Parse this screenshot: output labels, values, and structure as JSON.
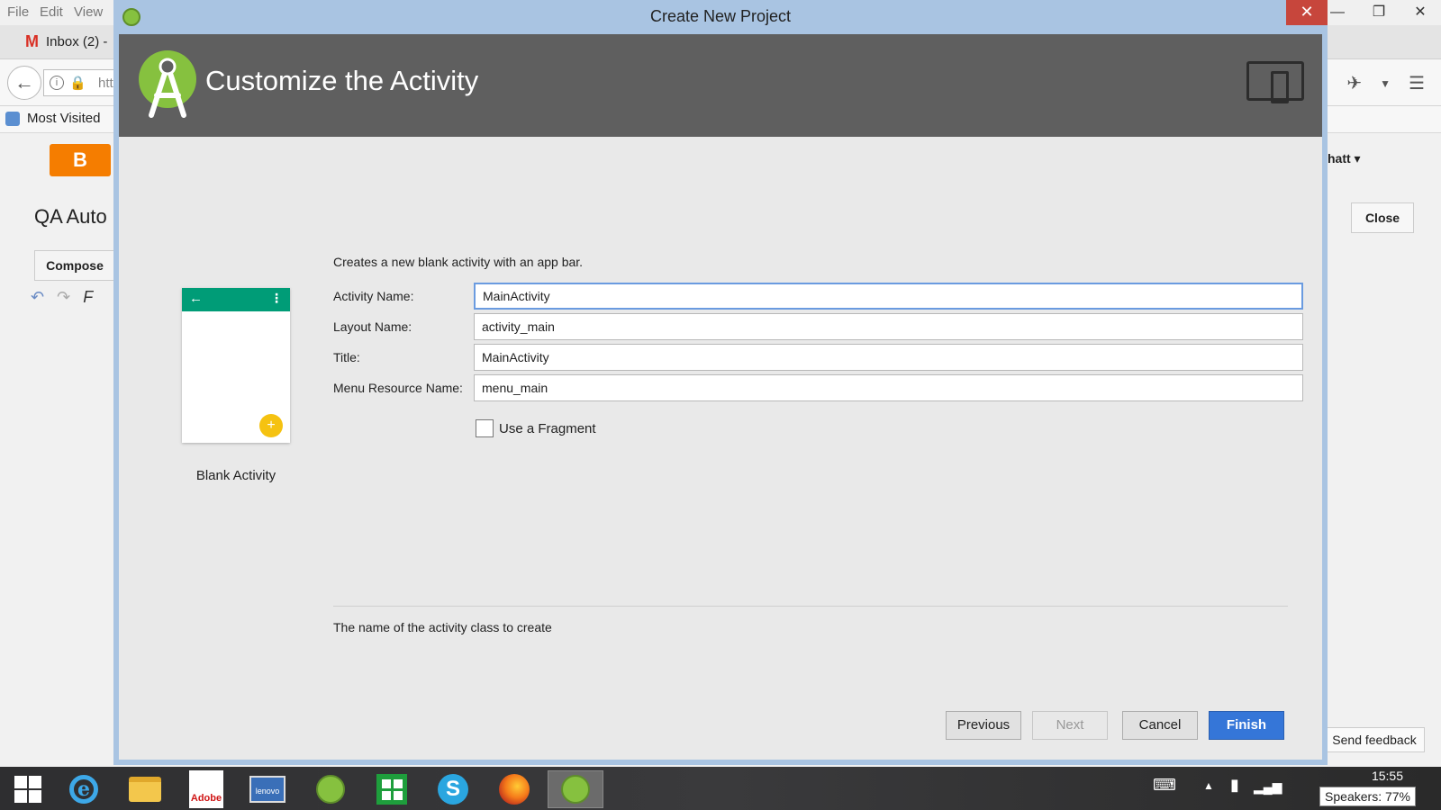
{
  "browser": {
    "menus": [
      "File",
      "Edit",
      "View"
    ],
    "tab_title": "Inbox (2) -",
    "url_fragment": "htt",
    "bookmarks_label": "Most Visited",
    "page_title": "QA Auto",
    "compose_label": "Compose",
    "user_name": "hatt",
    "close_label": "Close",
    "send_feedback_label": "Send feedback"
  },
  "dialog": {
    "window_title": "Create New Project",
    "header_title": "Customize the Activity",
    "description": "Creates a new blank activity with an app bar.",
    "preview_label": "Blank Activity",
    "fields": [
      {
        "label": "Activity Name:",
        "value": "MainActivity"
      },
      {
        "label": "Layout Name:",
        "value": "activity_main"
      },
      {
        "label": "Title:",
        "value": "MainActivity"
      },
      {
        "label": "Menu Resource Name:",
        "value": "menu_main"
      }
    ],
    "fragment_label": "Use a Fragment",
    "fragment_checked": false,
    "help_text": "The name of the activity class to create",
    "buttons": {
      "previous": "Previous",
      "next": "Next",
      "cancel": "Cancel",
      "finish": "Finish"
    }
  },
  "taskbar": {
    "time": "15:55",
    "volume_tooltip": "Speakers: 77%",
    "apps": [
      "start",
      "internet-explorer",
      "file-explorer",
      "adobe",
      "lenovo",
      "android-studio",
      "store",
      "skype",
      "firefox",
      "android-studio-active"
    ]
  },
  "colors": {
    "dialog_border": "#a9c4e2",
    "header_bg": "#5f5f5f",
    "finish_button": "#3576d8",
    "preview_appbar": "#009c77",
    "preview_fab": "#f5c211",
    "close_button": "#c7463c"
  }
}
